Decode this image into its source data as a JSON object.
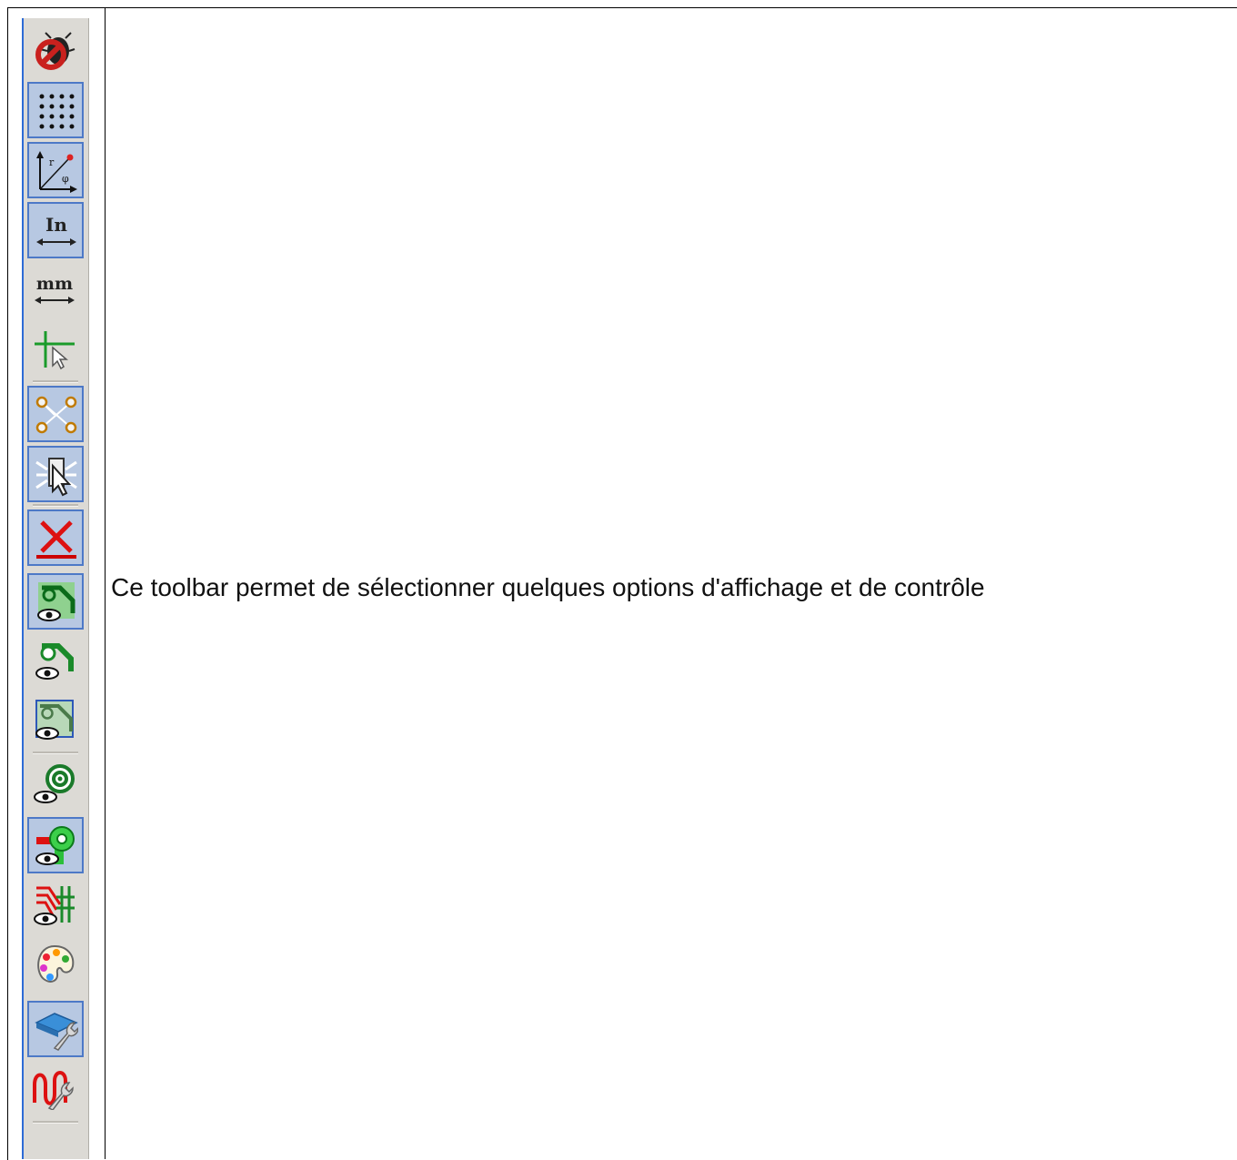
{
  "toolbar": {
    "buttons": [
      {
        "name": "drc-off-icon",
        "active": false
      },
      {
        "name": "grid-icon",
        "active": true
      },
      {
        "name": "polar-coords-icon",
        "active": true
      },
      {
        "name": "unit-inch-icon",
        "active": true,
        "label": "In"
      },
      {
        "name": "unit-mm-icon",
        "active": false,
        "label": "mm"
      },
      {
        "name": "full-cursor-icon",
        "active": false
      },
      {
        "name": "ratsnest-icon",
        "active": true
      },
      {
        "name": "local-ratsnest-icon",
        "active": true
      },
      {
        "name": "auto-delete-track-icon",
        "active": true
      },
      {
        "name": "pad-sketch-icon",
        "active": true
      },
      {
        "name": "via-sketch-icon",
        "active": false
      },
      {
        "name": "track-sketch-icon",
        "active": false
      },
      {
        "name": "show-zones-icon",
        "active": false
      },
      {
        "name": "show-zones-outline-icon",
        "active": true
      },
      {
        "name": "high-contrast-icon",
        "active": false
      },
      {
        "name": "layers-palette-icon",
        "active": false
      },
      {
        "name": "layers-manager-icon",
        "active": true
      },
      {
        "name": "microwave-tools-icon",
        "active": false
      }
    ]
  },
  "caption": "Ce toolbar permet de sélectionner quelques options d'affichage et de contrôle"
}
